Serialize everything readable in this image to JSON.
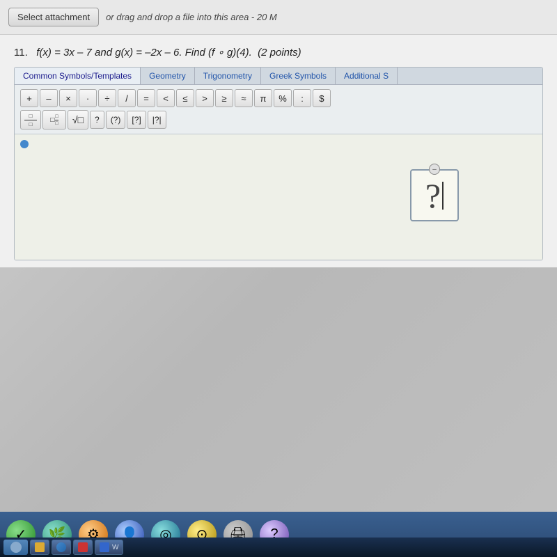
{
  "top_bar": {
    "select_btn_label": "Select attachment",
    "drag_drop_text": "or drag and drop a file into this area - 20 M"
  },
  "question": {
    "number": "11.",
    "text": "f(x) = 3x – 7 and g(x) = –2x – 6. Find (f ∘ g)(4).",
    "points": "(2 points)"
  },
  "math_editor": {
    "tabs": [
      {
        "label": "Common Symbols/Templates",
        "active": true
      },
      {
        "label": "Geometry",
        "active": false
      },
      {
        "label": "Trigonometry",
        "active": false
      },
      {
        "label": "Greek Symbols",
        "active": false
      },
      {
        "label": "Additional S",
        "active": false
      }
    ],
    "row1_symbols": [
      "+",
      "–",
      "×",
      "·",
      "÷",
      "/",
      "=",
      "<",
      "≤",
      ">",
      "≥",
      "≈",
      "π",
      "%",
      ":",
      "$"
    ],
    "row2_symbols": [
      "?",
      "(?)",
      "[?]",
      "|?|"
    ],
    "answer_placeholder": "?"
  },
  "taskbar": {
    "apps": [
      {
        "name": "acrobat",
        "label": "Acrobat"
      },
      {
        "name": "word",
        "label": "W"
      }
    ]
  }
}
